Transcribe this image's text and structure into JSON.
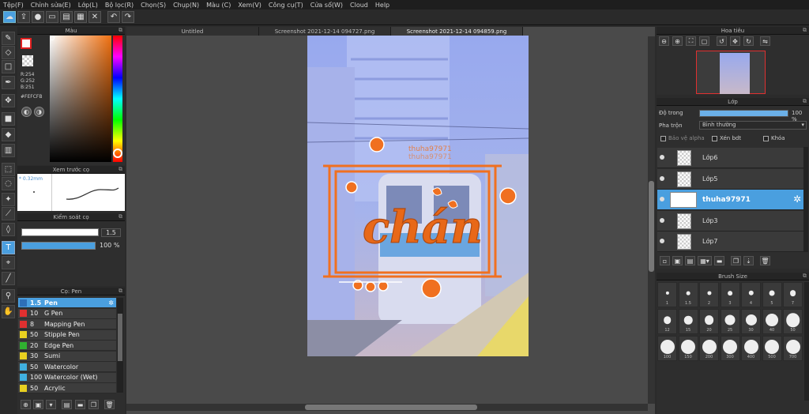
{
  "menu": [
    "Tệp(F)",
    "Chỉnh sửa(E)",
    "Lớp(L)",
    "Bộ lọc(R)",
    "Chọn(S)",
    "Chụp(N)",
    "Màu (C)",
    "Xem(V)",
    "Công cụ(T)",
    "Cửa sổ(W)",
    "Cloud",
    "Help"
  ],
  "color_panel": {
    "title": "Màu",
    "rgb_r": "R:254",
    "rgb_g": "G:252",
    "rgb_b": "B:251",
    "hex": "#FEFCFB",
    "fg": "#FEFCFB",
    "bg": "#e02020"
  },
  "brush_preview": {
    "title": "Xem trước cọ",
    "size": "* 0.32mm"
  },
  "brush_control": {
    "title": "Kiểm soát cọ",
    "size_value": "1.5",
    "opacity_value": "100 %"
  },
  "brush_list": {
    "title": "Cọ: Pen",
    "items": [
      {
        "size": "1.5",
        "name": "Pen",
        "color": "#2d6fb8",
        "selected": true
      },
      {
        "size": "10",
        "name": "G Pen",
        "color": "#e03030"
      },
      {
        "size": "8",
        "name": "Mapping Pen",
        "color": "#e03030"
      },
      {
        "size": "50",
        "name": "Stipple Pen",
        "color": "#e8d020"
      },
      {
        "size": "20",
        "name": "Edge Pen",
        "color": "#30b030"
      },
      {
        "size": "30",
        "name": "Sumi",
        "color": "#e8d020"
      },
      {
        "size": "50",
        "name": "Watercolor",
        "color": "#40b0e0"
      },
      {
        "size": "100",
        "name": "Watercolor (Wet)",
        "color": "#40b0e0"
      },
      {
        "size": "50",
        "name": "Acrylic",
        "color": "#e8d020"
      }
    ]
  },
  "tabs": [
    "Untitled",
    "Screenshot 2021-12-14 094727.png",
    "Screenshot 2021-12-14 094859.png"
  ],
  "artwork": {
    "watermark1": "thuha97971",
    "watermark2": "thuha97971",
    "lettering": "chán",
    "accent": "#f07020",
    "sky": "#8fa6e8"
  },
  "navigator": {
    "title": "Hoa tiêu"
  },
  "layers": {
    "title": "Lớp",
    "opacity_label": "Độ trong",
    "opacity_value": "100 %",
    "opacity_fraction": 1.0,
    "blend_label": "Pha trộn",
    "blend_value": "Bình thường",
    "protect_alpha": "Bảo vệ alpha",
    "clipping": "Xén bdt",
    "lock": "Khóa",
    "items": [
      {
        "name": "Lớp6",
        "selected": false
      },
      {
        "name": "Lớp5",
        "selected": false
      },
      {
        "name": "thuha97971",
        "selected": true
      },
      {
        "name": "Lớp3",
        "selected": false
      },
      {
        "name": "Lớp7",
        "selected": false
      }
    ]
  },
  "brush_size": {
    "title": "Brush Size",
    "sizes": [
      "1",
      "1.5",
      "2",
      "3",
      "4",
      "5",
      "7",
      "12",
      "15",
      "20",
      "25",
      "30",
      "40",
      "50",
      "100",
      "150",
      "200",
      "300",
      "400",
      "500",
      "700"
    ]
  }
}
